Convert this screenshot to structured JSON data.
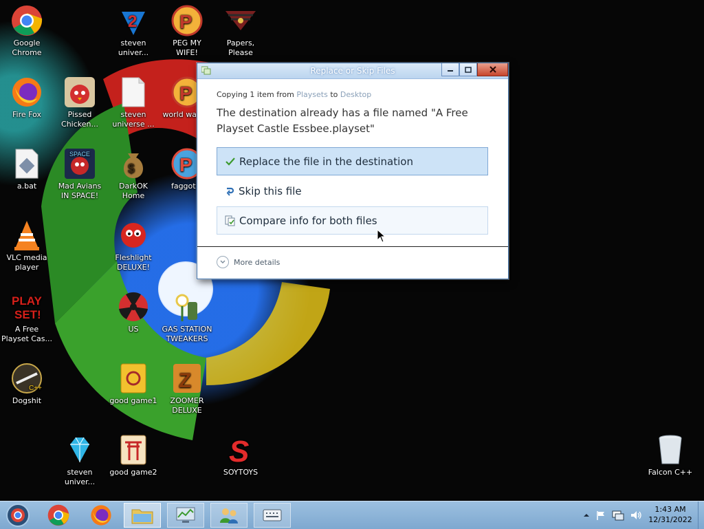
{
  "desktop": {
    "icons": [
      {
        "name": "google-chrome-icon",
        "label": "Google Chrome"
      },
      {
        "name": "steven-universe-icon",
        "label": "steven univer..."
      },
      {
        "name": "peg-my-wife-icon",
        "label": "PEG MY WIFE!"
      },
      {
        "name": "papers-please-icon",
        "label": "Papers, Please"
      },
      {
        "name": "firefox-icon",
        "label": "Fire Fox"
      },
      {
        "name": "pissed-chicken-icon",
        "label": "Pissed Chicken..."
      },
      {
        "name": "steven-universe-file-icon",
        "label": "steven universe ..."
      },
      {
        "name": "world-warcraft-icon",
        "label": "world warcra"
      },
      {
        "name": "bat-file-icon",
        "label": "a.bat"
      },
      {
        "name": "mad-avians-icon",
        "label": "Mad Avians IN SPACE!"
      },
      {
        "name": "darkok-home-icon",
        "label": "DarkOK Home"
      },
      {
        "name": "p-app-icon",
        "label": "faggot n"
      },
      {
        "name": "vlc-icon",
        "label": "VLC media player"
      },
      {
        "name": "fleshlight-deluxe-icon",
        "label": "Fleshlight DELUXE!"
      },
      {
        "name": "playset-icon",
        "label": "A Free Playset Cas..."
      },
      {
        "name": "us-radiation-icon",
        "label": "US"
      },
      {
        "name": "gas-station-tweakers-icon",
        "label": "GAS STATION TWEAKERS"
      },
      {
        "name": "dogshit-icon",
        "label": "Dogshit"
      },
      {
        "name": "good-game1-icon",
        "label": "good game1"
      },
      {
        "name": "zoomer-deluxe-icon",
        "label": "ZOOMER DELUXE"
      },
      {
        "name": "steven-universe-diamond-icon",
        "label": "steven univer..."
      },
      {
        "name": "good-game2-icon",
        "label": "good game2"
      },
      {
        "name": "soytoys-icon",
        "label": "SOYTOYS"
      },
      {
        "name": "recycle-bin-icon",
        "label": "Falcon C++"
      }
    ]
  },
  "dialog": {
    "title": "Replace or Skip Files",
    "copying_prefix": "Copying 1 item from ",
    "source": "Playsets",
    "copying_to": " to ",
    "destination": "Desktop",
    "message": "The destination already has a file named \"A Free Playset Castle Essbee.playset\"",
    "options": {
      "replace": "Replace the file in the destination",
      "skip": "Skip this file",
      "compare": "Compare info for both files"
    },
    "more_details": "More details"
  },
  "taskbar": {
    "items": [
      "start-orb-icon",
      "chrome-icon",
      "firefox-icon",
      "explorer-icon",
      "task-manager-icon",
      "network-users-icon",
      "keyboard-icon"
    ],
    "clock_time": "1:43 AM",
    "clock_date": "12/31/2022"
  }
}
